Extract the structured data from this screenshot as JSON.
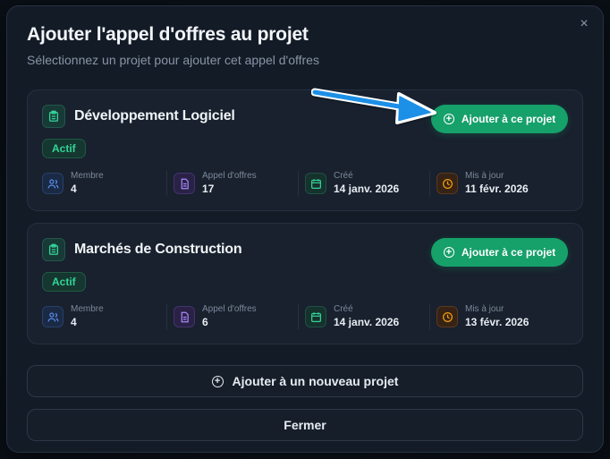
{
  "dialog": {
    "title": "Ajouter l'appel d'offres au projet",
    "subtitle": "Sélectionnez un projet pour ajouter cet appel d'offres",
    "close_icon": "×"
  },
  "projects": [
    {
      "name": "Développement Logiciel",
      "status": "Actif",
      "add_label": "Ajouter à ce projet",
      "stats": [
        {
          "label": "Membre",
          "value": "4"
        },
        {
          "label": "Appel d'offres",
          "value": "17"
        },
        {
          "label": "Créé",
          "value": "14 janv. 2026"
        },
        {
          "label": "Mis à jour",
          "value": "11 févr. 2026"
        }
      ]
    },
    {
      "name": "Marchés de Construction",
      "status": "Actif",
      "add_label": "Ajouter à ce projet",
      "stats": [
        {
          "label": "Membre",
          "value": "4"
        },
        {
          "label": "Appel d'offres",
          "value": "6"
        },
        {
          "label": "Créé",
          "value": "14 janv. 2026"
        },
        {
          "label": "Mis à jour",
          "value": "13 févr. 2026"
        }
      ]
    }
  ],
  "footer": {
    "new_project_label": "Ajouter à un nouveau projet",
    "close_label": "Fermer"
  },
  "colors": {
    "accent": "#16a06a",
    "status": "#34d399",
    "arrow": "#1e8fe6"
  },
  "icons": {
    "project": "clipboard-icon",
    "members": "users-icon",
    "tenders": "document-icon",
    "created": "calendar-icon",
    "updated": "clock-icon",
    "add": "plus-circle-icon",
    "close": "close-icon"
  }
}
